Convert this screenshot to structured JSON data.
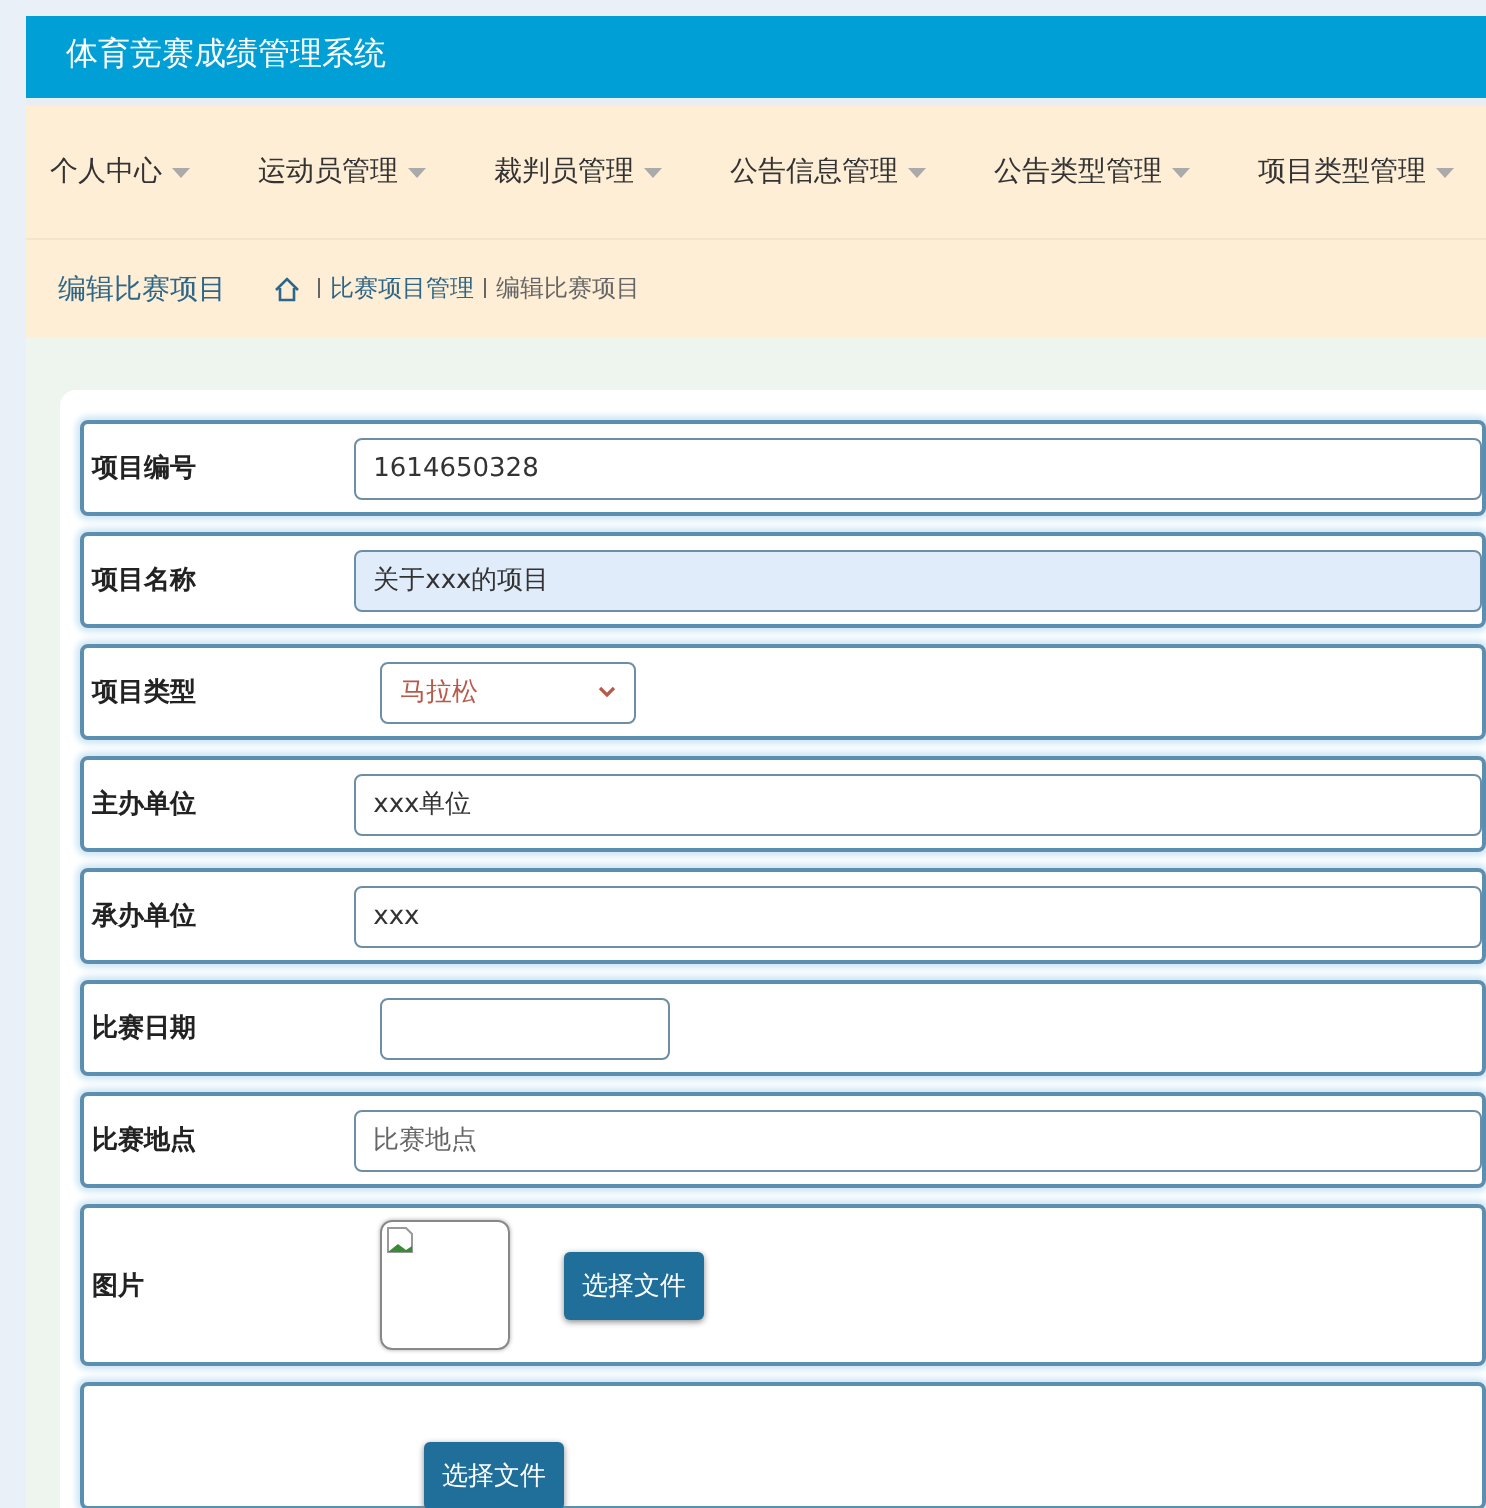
{
  "header": {
    "title": "体育竞赛成绩管理系统"
  },
  "nav": [
    {
      "label": "个人中心"
    },
    {
      "label": "运动员管理"
    },
    {
      "label": "裁判员管理"
    },
    {
      "label": "公告信息管理"
    },
    {
      "label": "公告类型管理"
    },
    {
      "label": "项目类型管理"
    }
  ],
  "breadcrumb": {
    "title": "编辑比赛项目",
    "path": [
      "比赛项目管理",
      "编辑比赛项目"
    ]
  },
  "form": [
    {
      "kind": "text",
      "label": "项目编号",
      "value": "1614650328",
      "autofilled": false
    },
    {
      "kind": "text",
      "label": "项目名称",
      "value": "关于xxx的项目",
      "autofilled": true
    },
    {
      "kind": "select",
      "label": "项目类型",
      "value": "马拉松"
    },
    {
      "kind": "text",
      "label": "主办单位",
      "value": "xxx单位",
      "autofilled": false
    },
    {
      "kind": "text",
      "label": "承办单位",
      "value": "xxx",
      "autofilled": false
    },
    {
      "kind": "date",
      "label": "比赛日期",
      "autofilled": false
    },
    {
      "kind": "text",
      "label": "比赛地点",
      "placeholder": "比赛地点",
      "autofilled": false
    },
    {
      "kind": "image",
      "label": "图片",
      "button": "选择文件"
    },
    {
      "kind": "file",
      "button": "选择文件"
    }
  ]
}
